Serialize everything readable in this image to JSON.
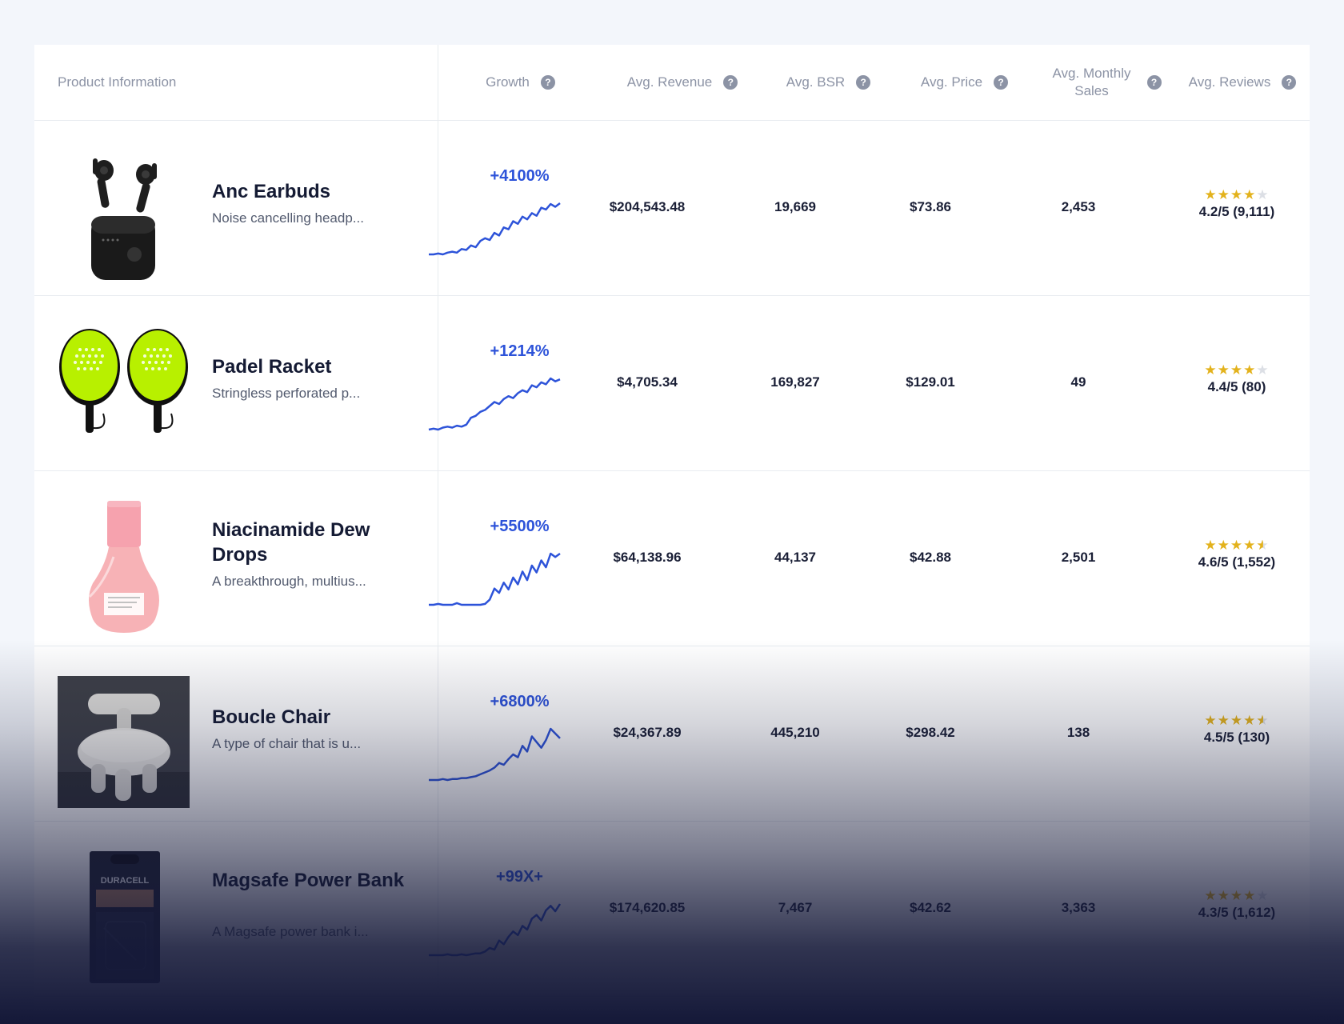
{
  "table": {
    "headers": {
      "product": "Product Information",
      "growth": "Growth",
      "revenue": "Avg. Revenue",
      "bsr": "Avg. BSR",
      "price": "Avg. Price",
      "monthly_sales": "Avg. Monthly Sales",
      "reviews": "Avg. Reviews"
    },
    "help_icon": "question-circle-icon",
    "rows": [
      {
        "name": "Anc Earbuds",
        "description": "Noise cancelling headp...",
        "image": "earbuds-image",
        "growth": "+4100%",
        "growth_trend": [
          10,
          10,
          11,
          10,
          12,
          13,
          12,
          16,
          15,
          20,
          18,
          25,
          28,
          26,
          34,
          31,
          40,
          38,
          47,
          44,
          52,
          49,
          56,
          53,
          62,
          60,
          66,
          63,
          67
        ],
        "revenue": "$204,543.48",
        "bsr": "19,669",
        "price": "$73.86",
        "monthly_sales": "2,453",
        "rating": 4.2,
        "rating_text": "4.2/5 (9,111)"
      },
      {
        "name": "Padel Racket",
        "description": "Stringless perforated p...",
        "image": "padel-racket-image",
        "growth": "+1214%",
        "growth_trend": [
          10,
          11,
          10,
          12,
          13,
          12,
          14,
          13,
          15,
          22,
          24,
          28,
          30,
          34,
          38,
          36,
          41,
          44,
          42,
          47,
          50,
          48,
          55,
          53,
          58,
          56,
          62,
          59,
          61
        ],
        "revenue": "$4,705.34",
        "bsr": "169,827",
        "price": "$129.01",
        "monthly_sales": "49",
        "rating": 4.4,
        "rating_text": "4.4/5 (80)"
      },
      {
        "name": "Niacinamide Dew Drops",
        "description": "A breakthrough, multius...",
        "image": "serum-bottle-image",
        "growth": "+5500%",
        "growth_trend": [
          6,
          6,
          7,
          6,
          6,
          6,
          8,
          6,
          6,
          6,
          6,
          6,
          7,
          12,
          25,
          20,
          32,
          24,
          38,
          30,
          45,
          35,
          52,
          44,
          58,
          50,
          66,
          62,
          66
        ],
        "revenue": "$64,138.96",
        "bsr": "44,137",
        "price": "$42.88",
        "monthly_sales": "2,501",
        "rating": 4.6,
        "rating_text": "4.6/5 (1,552)"
      },
      {
        "name": "Boucle Chair",
        "description": "A type of chair that is u...",
        "image": "boucle-chair-image",
        "growth": "+6800%",
        "growth_trend": [
          6,
          6,
          6,
          7,
          6,
          7,
          7,
          8,
          8,
          9,
          10,
          12,
          14,
          16,
          19,
          24,
          22,
          28,
          33,
          30,
          42,
          36,
          52,
          46,
          40,
          48,
          60,
          55,
          50
        ],
        "revenue": "$24,367.89",
        "bsr": "445,210",
        "price": "$298.42",
        "monthly_sales": "138",
        "rating": 4.5,
        "rating_text": "4.5/5 (130)"
      },
      {
        "name": "Magsafe Power Bank",
        "description": "A Magsafe power bank i...",
        "image": "power-bank-image",
        "growth": "+99X+",
        "growth_trend": [
          6,
          6,
          6,
          6,
          7,
          6,
          6,
          7,
          6,
          7,
          8,
          8,
          10,
          14,
          12,
          22,
          18,
          26,
          32,
          28,
          38,
          34,
          46,
          50,
          44,
          55,
          60,
          54,
          62
        ],
        "revenue": "$174,620.85",
        "bsr": "7,467",
        "price": "$42.62",
        "monthly_sales": "3,363",
        "rating": 4.3,
        "rating_text": "4.3/5 (1,612)"
      }
    ]
  },
  "colors": {
    "accent": "#2d53d9",
    "star": "#e3b21c",
    "fade": "#141838"
  }
}
